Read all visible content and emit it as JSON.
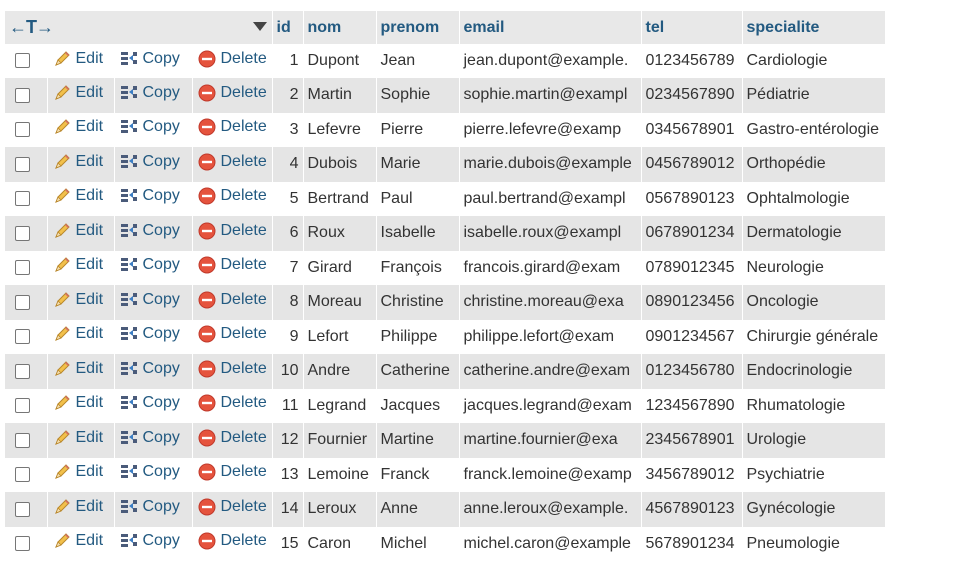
{
  "header": {
    "column_control": "←T→",
    "columns": [
      "id",
      "nom",
      "prenom",
      "email",
      "tel",
      "specialite"
    ]
  },
  "actions": {
    "edit": "Edit",
    "copy": "Copy",
    "delete": "Delete"
  },
  "rows": [
    {
      "id": "1",
      "nom": "Dupont",
      "prenom": "Jean",
      "email": "jean.dupont@example.",
      "tel": "0123456789",
      "specialite": "Cardiologie"
    },
    {
      "id": "2",
      "nom": "Martin",
      "prenom": "Sophie",
      "email": "sophie.martin@exampl",
      "tel": "0234567890",
      "specialite": "Pédiatrie"
    },
    {
      "id": "3",
      "nom": "Lefevre",
      "prenom": "Pierre",
      "email": "pierre.lefevre@examp",
      "tel": "0345678901",
      "specialite": "Gastro-entérologie"
    },
    {
      "id": "4",
      "nom": "Dubois",
      "prenom": "Marie",
      "email": "marie.dubois@example",
      "tel": "0456789012",
      "specialite": "Orthopédie"
    },
    {
      "id": "5",
      "nom": "Bertrand",
      "prenom": "Paul",
      "email": "paul.bertrand@exampl",
      "tel": "0567890123",
      "specialite": "Ophtalmologie"
    },
    {
      "id": "6",
      "nom": "Roux",
      "prenom": "Isabelle",
      "email": "isabelle.roux@exampl",
      "tel": "0678901234",
      "specialite": "Dermatologie"
    },
    {
      "id": "7",
      "nom": "Girard",
      "prenom": "François",
      "email": "francois.girard@exam",
      "tel": "0789012345",
      "specialite": "Neurologie"
    },
    {
      "id": "8",
      "nom": "Moreau",
      "prenom": "Christine",
      "email": "christine.moreau@exa",
      "tel": "0890123456",
      "specialite": "Oncologie"
    },
    {
      "id": "9",
      "nom": "Lefort",
      "prenom": "Philippe",
      "email": "philippe.lefort@exam",
      "tel": "0901234567",
      "specialite": "Chirurgie générale"
    },
    {
      "id": "10",
      "nom": "Andre",
      "prenom": "Catherine",
      "email": "catherine.andre@exam",
      "tel": "0123456780",
      "specialite": "Endocrinologie"
    },
    {
      "id": "11",
      "nom": "Legrand",
      "prenom": "Jacques",
      "email": "jacques.legrand@exam",
      "tel": "1234567890",
      "specialite": "Rhumatologie"
    },
    {
      "id": "12",
      "nom": "Fournier",
      "prenom": "Martine",
      "email": "martine.fournier@exa",
      "tel": "2345678901",
      "specialite": "Urologie"
    },
    {
      "id": "13",
      "nom": "Lemoine",
      "prenom": "Franck",
      "email": "franck.lemoine@examp",
      "tel": "3456789012",
      "specialite": "Psychiatrie"
    },
    {
      "id": "14",
      "nom": "Leroux",
      "prenom": "Anne",
      "email": "anne.leroux@example.",
      "tel": "4567890123",
      "specialite": "Gynécologie"
    },
    {
      "id": "15",
      "nom": "Caron",
      "prenom": "Michel",
      "email": "michel.caron@example",
      "tel": "5678901234",
      "specialite": "Pneumologie"
    }
  ],
  "colors": {
    "link": "#235a81",
    "header_bg": "#e8e8e8",
    "row_alt_bg": "#e5e5e5",
    "delete_red": "#e5533d",
    "pencil": "#e3a72f"
  },
  "icons": {
    "edit": "pencil-icon",
    "copy": "copy-icon",
    "delete": "delete-icon",
    "sort": "sort-dropdown-icon"
  }
}
